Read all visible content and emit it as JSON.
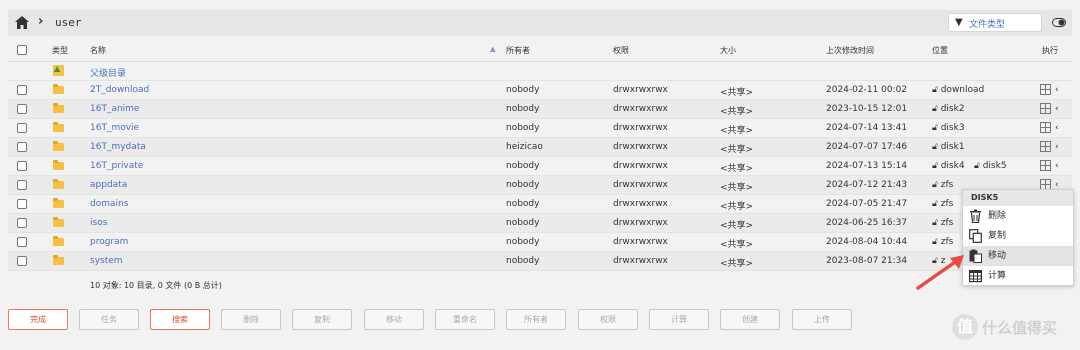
{
  "breadcrumb": {
    "path": "user",
    "separator": "›"
  },
  "filter": {
    "label": "文件类型"
  },
  "header": {
    "type": "类型",
    "name": "名称",
    "owner": "所有者",
    "perms": "权限",
    "size": "大小",
    "modified": "上次修改时间",
    "location": "位置",
    "exec": "执行"
  },
  "parent": {
    "label": "父级目录"
  },
  "rows": [
    {
      "name": "2T_download",
      "owner": "nobody",
      "perms": "drwxrwxrwx",
      "size": "<共享>",
      "modified": "2024-02-11 00:02",
      "loc": "download",
      "loc2": ""
    },
    {
      "name": "16T_anime",
      "owner": "nobody",
      "perms": "drwxrwxrwx",
      "size": "<共享>",
      "modified": "2023-10-15 12:01",
      "loc": "disk2",
      "loc2": ""
    },
    {
      "name": "16T_movie",
      "owner": "nobody",
      "perms": "drwxrwxrwx",
      "size": "<共享>",
      "modified": "2024-07-14 13:41",
      "loc": "disk3",
      "loc2": ""
    },
    {
      "name": "16T_mydata",
      "owner": "heizicao",
      "perms": "drwxrwxrwx",
      "size": "<共享>",
      "modified": "2024-07-07 17:46",
      "loc": "disk1",
      "loc2": ""
    },
    {
      "name": "16T_private",
      "owner": "nobody",
      "perms": "drwxrwxrwx",
      "size": "<共享>",
      "modified": "2024-07-13 15:14",
      "loc": "disk4",
      "loc2": "disk5"
    },
    {
      "name": "appdata",
      "owner": "nobody",
      "perms": "drwxrwxrwx",
      "size": "<共享>",
      "modified": "2024-07-12 21:43",
      "loc": "zfs",
      "loc2": ""
    },
    {
      "name": "domains",
      "owner": "nobody",
      "perms": "drwxrwxrwx",
      "size": "<共享>",
      "modified": "2024-07-05 21:47",
      "loc": "zfs",
      "loc2": ""
    },
    {
      "name": "isos",
      "owner": "nobody",
      "perms": "drwxrwxrwx",
      "size": "<共享>",
      "modified": "2024-06-25 16:37",
      "loc": "zfs",
      "loc2": ""
    },
    {
      "name": "program",
      "owner": "nobody",
      "perms": "drwxrwxrwx",
      "size": "<共享>",
      "modified": "2024-08-04 10:44",
      "loc": "zfs",
      "loc2": ""
    },
    {
      "name": "system",
      "owner": "nobody",
      "perms": "drwxrwxrwx",
      "size": "<共享>",
      "modified": "2023-08-07 21:34",
      "loc": "z",
      "loc2": ""
    }
  ],
  "summary": "10 对象: 10 目录, 0 文件 (0 B 总计)",
  "buttons": [
    "完成",
    "任务",
    "搜索",
    "删除",
    "复制",
    "移动",
    "重命名",
    "所有者",
    "权限",
    "计算",
    "创建",
    "上传"
  ],
  "context_menu": {
    "title": "DISK5",
    "items": [
      "删除",
      "复制",
      "移动",
      "计算"
    ]
  },
  "watermark": {
    "glyph": "值",
    "text": "什么值得买"
  },
  "colors": {
    "link": "#4a6fbd",
    "accent": "#e24f2f",
    "arrow": "#e64a45",
    "folder": "#f5c043"
  }
}
